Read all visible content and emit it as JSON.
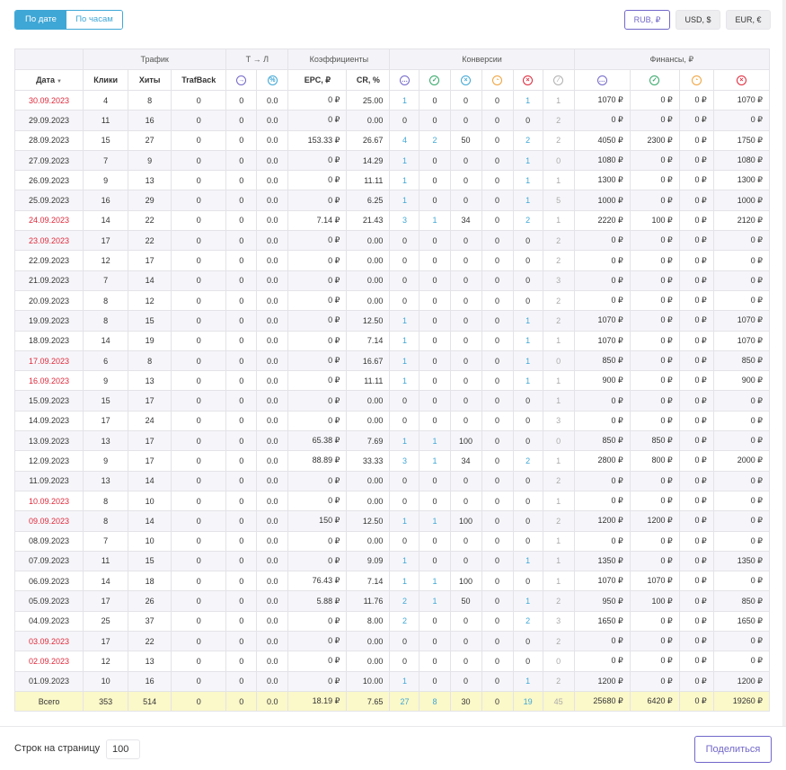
{
  "period_toggle": {
    "by_date": "По дате",
    "by_hours": "По часам",
    "active": "by_date"
  },
  "currency": {
    "rub": "RUB, ₽",
    "usd": "USD, $",
    "eur": "EUR, €",
    "active": "rub"
  },
  "groups": {
    "traffic": "Трафик",
    "tl": "Т → Л",
    "coeffs": "Коэффициенты",
    "conversions": "Конверсии",
    "finance": "Финансы, ₽"
  },
  "columns": {
    "date": "Дата",
    "clicks": "Клики",
    "hits": "Хиты",
    "trafback": "TrafBack",
    "epc": "EPC, ₽",
    "cr": "CR, %"
  },
  "icon_names": [
    "arrow-right-icon",
    "percent-icon",
    "dots-icon",
    "check-icon",
    "x-circle-icon",
    "clock-icon",
    "x-circle-icon",
    "ban-icon",
    "dots-icon",
    "check-icon",
    "clock-icon",
    "x-circle-icon"
  ],
  "colors": {
    "accent": "#3fa7d6",
    "purple": "#7167c9",
    "weekend": "#e0283a",
    "total_bg": "#fbf8c9"
  },
  "rows": [
    {
      "date": "30.09.2023",
      "weekend": true,
      "clicks": "4",
      "hits": "8",
      "trafback": "0",
      "tl1": "0",
      "tl2": "0.0",
      "epc": "0 ₽",
      "cr": "25.00",
      "cv": [
        "1",
        "0",
        "0",
        "0",
        "1",
        "1"
      ],
      "fin": [
        "1070 ₽",
        "0 ₽",
        "0 ₽",
        "1070 ₽"
      ]
    },
    {
      "date": "29.09.2023",
      "weekend": false,
      "clicks": "11",
      "hits": "16",
      "trafback": "0",
      "tl1": "0",
      "tl2": "0.0",
      "epc": "0 ₽",
      "cr": "0.00",
      "cv": [
        "0",
        "0",
        "0",
        "0",
        "0",
        "2"
      ],
      "fin": [
        "0 ₽",
        "0 ₽",
        "0 ₽",
        "0 ₽"
      ]
    },
    {
      "date": "28.09.2023",
      "weekend": false,
      "clicks": "15",
      "hits": "27",
      "trafback": "0",
      "tl1": "0",
      "tl2": "0.0",
      "epc": "153.33 ₽",
      "cr": "26.67",
      "cv": [
        "4",
        "2",
        "50",
        "0",
        "2",
        "2"
      ],
      "fin": [
        "4050 ₽",
        "2300 ₽",
        "0 ₽",
        "1750 ₽"
      ]
    },
    {
      "date": "27.09.2023",
      "weekend": false,
      "clicks": "7",
      "hits": "9",
      "trafback": "0",
      "tl1": "0",
      "tl2": "0.0",
      "epc": "0 ₽",
      "cr": "14.29",
      "cv": [
        "1",
        "0",
        "0",
        "0",
        "1",
        "0"
      ],
      "fin": [
        "1080 ₽",
        "0 ₽",
        "0 ₽",
        "1080 ₽"
      ]
    },
    {
      "date": "26.09.2023",
      "weekend": false,
      "clicks": "9",
      "hits": "13",
      "trafback": "0",
      "tl1": "0",
      "tl2": "0.0",
      "epc": "0 ₽",
      "cr": "11.11",
      "cv": [
        "1",
        "0",
        "0",
        "0",
        "1",
        "1"
      ],
      "fin": [
        "1300 ₽",
        "0 ₽",
        "0 ₽",
        "1300 ₽"
      ]
    },
    {
      "date": "25.09.2023",
      "weekend": false,
      "clicks": "16",
      "hits": "29",
      "trafback": "0",
      "tl1": "0",
      "tl2": "0.0",
      "epc": "0 ₽",
      "cr": "6.25",
      "cv": [
        "1",
        "0",
        "0",
        "0",
        "1",
        "5"
      ],
      "fin": [
        "1000 ₽",
        "0 ₽",
        "0 ₽",
        "1000 ₽"
      ]
    },
    {
      "date": "24.09.2023",
      "weekend": true,
      "clicks": "14",
      "hits": "22",
      "trafback": "0",
      "tl1": "0",
      "tl2": "0.0",
      "epc": "7.14 ₽",
      "cr": "21.43",
      "cv": [
        "3",
        "1",
        "34",
        "0",
        "2",
        "1"
      ],
      "fin": [
        "2220 ₽",
        "100 ₽",
        "0 ₽",
        "2120 ₽"
      ]
    },
    {
      "date": "23.09.2023",
      "weekend": true,
      "clicks": "17",
      "hits": "22",
      "trafback": "0",
      "tl1": "0",
      "tl2": "0.0",
      "epc": "0 ₽",
      "cr": "0.00",
      "cv": [
        "0",
        "0",
        "0",
        "0",
        "0",
        "2"
      ],
      "fin": [
        "0 ₽",
        "0 ₽",
        "0 ₽",
        "0 ₽"
      ]
    },
    {
      "date": "22.09.2023",
      "weekend": false,
      "clicks": "12",
      "hits": "17",
      "trafback": "0",
      "tl1": "0",
      "tl2": "0.0",
      "epc": "0 ₽",
      "cr": "0.00",
      "cv": [
        "0",
        "0",
        "0",
        "0",
        "0",
        "2"
      ],
      "fin": [
        "0 ₽",
        "0 ₽",
        "0 ₽",
        "0 ₽"
      ]
    },
    {
      "date": "21.09.2023",
      "weekend": false,
      "clicks": "7",
      "hits": "14",
      "trafback": "0",
      "tl1": "0",
      "tl2": "0.0",
      "epc": "0 ₽",
      "cr": "0.00",
      "cv": [
        "0",
        "0",
        "0",
        "0",
        "0",
        "3"
      ],
      "fin": [
        "0 ₽",
        "0 ₽",
        "0 ₽",
        "0 ₽"
      ]
    },
    {
      "date": "20.09.2023",
      "weekend": false,
      "clicks": "8",
      "hits": "12",
      "trafback": "0",
      "tl1": "0",
      "tl2": "0.0",
      "epc": "0 ₽",
      "cr": "0.00",
      "cv": [
        "0",
        "0",
        "0",
        "0",
        "0",
        "2"
      ],
      "fin": [
        "0 ₽",
        "0 ₽",
        "0 ₽",
        "0 ₽"
      ]
    },
    {
      "date": "19.09.2023",
      "weekend": false,
      "clicks": "8",
      "hits": "15",
      "trafback": "0",
      "tl1": "0",
      "tl2": "0.0",
      "epc": "0 ₽",
      "cr": "12.50",
      "cv": [
        "1",
        "0",
        "0",
        "0",
        "1",
        "2"
      ],
      "fin": [
        "1070 ₽",
        "0 ₽",
        "0 ₽",
        "1070 ₽"
      ]
    },
    {
      "date": "18.09.2023",
      "weekend": false,
      "clicks": "14",
      "hits": "19",
      "trafback": "0",
      "tl1": "0",
      "tl2": "0.0",
      "epc": "0 ₽",
      "cr": "7.14",
      "cv": [
        "1",
        "0",
        "0",
        "0",
        "1",
        "1"
      ],
      "fin": [
        "1070 ₽",
        "0 ₽",
        "0 ₽",
        "1070 ₽"
      ]
    },
    {
      "date": "17.09.2023",
      "weekend": true,
      "clicks": "6",
      "hits": "8",
      "trafback": "0",
      "tl1": "0",
      "tl2": "0.0",
      "epc": "0 ₽",
      "cr": "16.67",
      "cv": [
        "1",
        "0",
        "0",
        "0",
        "1",
        "0"
      ],
      "fin": [
        "850 ₽",
        "0 ₽",
        "0 ₽",
        "850 ₽"
      ]
    },
    {
      "date": "16.09.2023",
      "weekend": true,
      "clicks": "9",
      "hits": "13",
      "trafback": "0",
      "tl1": "0",
      "tl2": "0.0",
      "epc": "0 ₽",
      "cr": "11.11",
      "cv": [
        "1",
        "0",
        "0",
        "0",
        "1",
        "1"
      ],
      "fin": [
        "900 ₽",
        "0 ₽",
        "0 ₽",
        "900 ₽"
      ]
    },
    {
      "date": "15.09.2023",
      "weekend": false,
      "clicks": "15",
      "hits": "17",
      "trafback": "0",
      "tl1": "0",
      "tl2": "0.0",
      "epc": "0 ₽",
      "cr": "0.00",
      "cv": [
        "0",
        "0",
        "0",
        "0",
        "0",
        "1"
      ],
      "fin": [
        "0 ₽",
        "0 ₽",
        "0 ₽",
        "0 ₽"
      ]
    },
    {
      "date": "14.09.2023",
      "weekend": false,
      "clicks": "17",
      "hits": "24",
      "trafback": "0",
      "tl1": "0",
      "tl2": "0.0",
      "epc": "0 ₽",
      "cr": "0.00",
      "cv": [
        "0",
        "0",
        "0",
        "0",
        "0",
        "3"
      ],
      "fin": [
        "0 ₽",
        "0 ₽",
        "0 ₽",
        "0 ₽"
      ]
    },
    {
      "date": "13.09.2023",
      "weekend": false,
      "clicks": "13",
      "hits": "17",
      "trafback": "0",
      "tl1": "0",
      "tl2": "0.0",
      "epc": "65.38 ₽",
      "cr": "7.69",
      "cv": [
        "1",
        "1",
        "100",
        "0",
        "0",
        "0"
      ],
      "fin": [
        "850 ₽",
        "850 ₽",
        "0 ₽",
        "0 ₽"
      ]
    },
    {
      "date": "12.09.2023",
      "weekend": false,
      "clicks": "9",
      "hits": "17",
      "trafback": "0",
      "tl1": "0",
      "tl2": "0.0",
      "epc": "88.89 ₽",
      "cr": "33.33",
      "cv": [
        "3",
        "1",
        "34",
        "0",
        "2",
        "1"
      ],
      "fin": [
        "2800 ₽",
        "800 ₽",
        "0 ₽",
        "2000 ₽"
      ]
    },
    {
      "date": "11.09.2023",
      "weekend": false,
      "clicks": "13",
      "hits": "14",
      "trafback": "0",
      "tl1": "0",
      "tl2": "0.0",
      "epc": "0 ₽",
      "cr": "0.00",
      "cv": [
        "0",
        "0",
        "0",
        "0",
        "0",
        "2"
      ],
      "fin": [
        "0 ₽",
        "0 ₽",
        "0 ₽",
        "0 ₽"
      ]
    },
    {
      "date": "10.09.2023",
      "weekend": true,
      "clicks": "8",
      "hits": "10",
      "trafback": "0",
      "tl1": "0",
      "tl2": "0.0",
      "epc": "0 ₽",
      "cr": "0.00",
      "cv": [
        "0",
        "0",
        "0",
        "0",
        "0",
        "1"
      ],
      "fin": [
        "0 ₽",
        "0 ₽",
        "0 ₽",
        "0 ₽"
      ]
    },
    {
      "date": "09.09.2023",
      "weekend": true,
      "clicks": "8",
      "hits": "14",
      "trafback": "0",
      "tl1": "0",
      "tl2": "0.0",
      "epc": "150 ₽",
      "cr": "12.50",
      "cv": [
        "1",
        "1",
        "100",
        "0",
        "0",
        "2"
      ],
      "fin": [
        "1200 ₽",
        "1200 ₽",
        "0 ₽",
        "0 ₽"
      ]
    },
    {
      "date": "08.09.2023",
      "weekend": false,
      "clicks": "7",
      "hits": "10",
      "trafback": "0",
      "tl1": "0",
      "tl2": "0.0",
      "epc": "0 ₽",
      "cr": "0.00",
      "cv": [
        "0",
        "0",
        "0",
        "0",
        "0",
        "1"
      ],
      "fin": [
        "0 ₽",
        "0 ₽",
        "0 ₽",
        "0 ₽"
      ]
    },
    {
      "date": "07.09.2023",
      "weekend": false,
      "clicks": "11",
      "hits": "15",
      "trafback": "0",
      "tl1": "0",
      "tl2": "0.0",
      "epc": "0 ₽",
      "cr": "9.09",
      "cv": [
        "1",
        "0",
        "0",
        "0",
        "1",
        "1"
      ],
      "fin": [
        "1350 ₽",
        "0 ₽",
        "0 ₽",
        "1350 ₽"
      ]
    },
    {
      "date": "06.09.2023",
      "weekend": false,
      "clicks": "14",
      "hits": "18",
      "trafback": "0",
      "tl1": "0",
      "tl2": "0.0",
      "epc": "76.43 ₽",
      "cr": "7.14",
      "cv": [
        "1",
        "1",
        "100",
        "0",
        "0",
        "1"
      ],
      "fin": [
        "1070 ₽",
        "1070 ₽",
        "0 ₽",
        "0 ₽"
      ]
    },
    {
      "date": "05.09.2023",
      "weekend": false,
      "clicks": "17",
      "hits": "26",
      "trafback": "0",
      "tl1": "0",
      "tl2": "0.0",
      "epc": "5.88 ₽",
      "cr": "11.76",
      "cv": [
        "2",
        "1",
        "50",
        "0",
        "1",
        "2"
      ],
      "fin": [
        "950 ₽",
        "100 ₽",
        "0 ₽",
        "850 ₽"
      ]
    },
    {
      "date": "04.09.2023",
      "weekend": false,
      "clicks": "25",
      "hits": "37",
      "trafback": "0",
      "tl1": "0",
      "tl2": "0.0",
      "epc": "0 ₽",
      "cr": "8.00",
      "cv": [
        "2",
        "0",
        "0",
        "0",
        "2",
        "3"
      ],
      "fin": [
        "1650 ₽",
        "0 ₽",
        "0 ₽",
        "1650 ₽"
      ]
    },
    {
      "date": "03.09.2023",
      "weekend": true,
      "clicks": "17",
      "hits": "22",
      "trafback": "0",
      "tl1": "0",
      "tl2": "0.0",
      "epc": "0 ₽",
      "cr": "0.00",
      "cv": [
        "0",
        "0",
        "0",
        "0",
        "0",
        "2"
      ],
      "fin": [
        "0 ₽",
        "0 ₽",
        "0 ₽",
        "0 ₽"
      ]
    },
    {
      "date": "02.09.2023",
      "weekend": true,
      "clicks": "12",
      "hits": "13",
      "trafback": "0",
      "tl1": "0",
      "tl2": "0.0",
      "epc": "0 ₽",
      "cr": "0.00",
      "cv": [
        "0",
        "0",
        "0",
        "0",
        "0",
        "0"
      ],
      "fin": [
        "0 ₽",
        "0 ₽",
        "0 ₽",
        "0 ₽"
      ]
    },
    {
      "date": "01.09.2023",
      "weekend": false,
      "clicks": "10",
      "hits": "16",
      "trafback": "0",
      "tl1": "0",
      "tl2": "0.0",
      "epc": "0 ₽",
      "cr": "10.00",
      "cv": [
        "1",
        "0",
        "0",
        "0",
        "1",
        "2"
      ],
      "fin": [
        "1200 ₽",
        "0 ₽",
        "0 ₽",
        "1200 ₽"
      ]
    }
  ],
  "total": {
    "label": "Всего",
    "clicks": "353",
    "hits": "514",
    "trafback": "0",
    "tl1": "0",
    "tl2": "0.0",
    "epc": "18.19 ₽",
    "cr": "7.65",
    "cv": [
      "27",
      "8",
      "30",
      "0",
      "19",
      "45"
    ],
    "fin": [
      "25680 ₽",
      "6420 ₽",
      "0 ₽",
      "19260 ₽"
    ]
  },
  "footer": {
    "rows_per_page_label": "Строк на страницу",
    "rows_per_page_value": "100",
    "share_label": "Поделиться"
  }
}
